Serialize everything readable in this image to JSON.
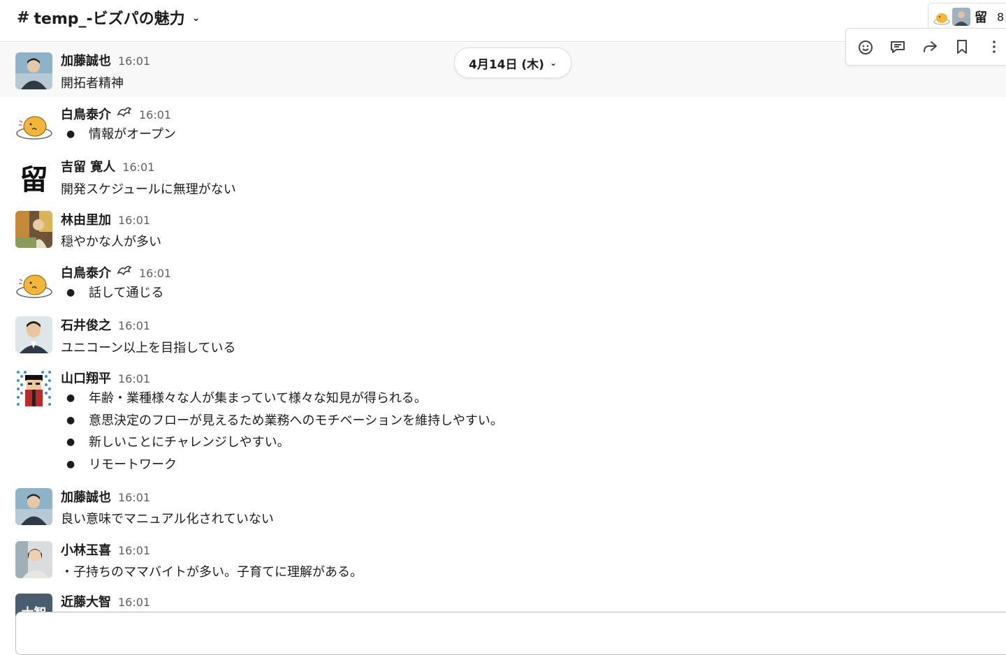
{
  "header": {
    "hash": "#",
    "channel_name": "temp_-ビズパの魅力",
    "member_avatar_3": "留",
    "member_count": "8"
  },
  "date_divider": {
    "label": "4月14日 (木)"
  },
  "hover_toolbar": {
    "icons": [
      "add-reaction-icon",
      "reply-thread-icon",
      "share-icon",
      "bookmark-icon",
      "more-actions-icon"
    ]
  },
  "messages": [
    {
      "name": "加藤誠也",
      "time": "16:01",
      "text": "開拓者精神"
    },
    {
      "name": "白鳥泰介",
      "time": "16:01",
      "bullets": [
        "情報がオープン"
      ]
    },
    {
      "name": "吉留 寛人",
      "time": "16:01",
      "avatar_text": "留",
      "text": "開発スケジュールに無理がない"
    },
    {
      "name": "林由里加",
      "time": "16:01",
      "text": "穏やかな人が多い"
    },
    {
      "name": "白鳥泰介",
      "time": "16:01",
      "bullets": [
        "話して通じる"
      ]
    },
    {
      "name": "石井俊之",
      "time": "16:01",
      "text": "ユニコーン以上を目指している"
    },
    {
      "name": "山口翔平",
      "time": "16:01",
      "bullets": [
        "年齢・業種様々な人が集まっていて様々な知見が得られる。",
        "意思決定のフローが見えるため業務へのモチベーションを維持しやすい。",
        "新しいことにチャレンジしやすい。",
        "リモートワーク"
      ]
    },
    {
      "name": "加藤誠也",
      "time": "16:01",
      "text": "良い意味でマニュアル化されていない"
    },
    {
      "name": "小林玉喜",
      "time": "16:01",
      "text": "・子持ちのママバイトが多い。子育てに理解がある。"
    },
    {
      "name": "近藤大智",
      "time": "16:01",
      "avatar_text": "大智"
    }
  ],
  "colors": {
    "text": "#1d1c1d",
    "muted": "#616061",
    "border": "#dddddd",
    "hover_bg": "#f8f8f8"
  }
}
